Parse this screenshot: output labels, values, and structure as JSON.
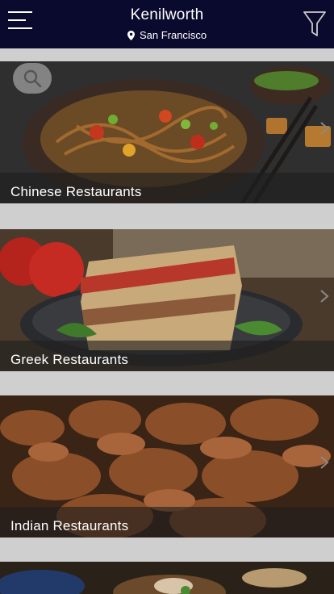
{
  "header": {
    "title": "Kenilworth",
    "location": "San Francisco",
    "colors": {
      "bar": "#0a0a2e",
      "text": "#ffffff"
    }
  },
  "search": {
    "icon": "search-icon"
  },
  "categories": [
    {
      "label": "Chinese Restaurants"
    },
    {
      "label": "Greek Restaurants"
    },
    {
      "label": "Indian Restaurants"
    },
    {
      "label": ""
    }
  ]
}
